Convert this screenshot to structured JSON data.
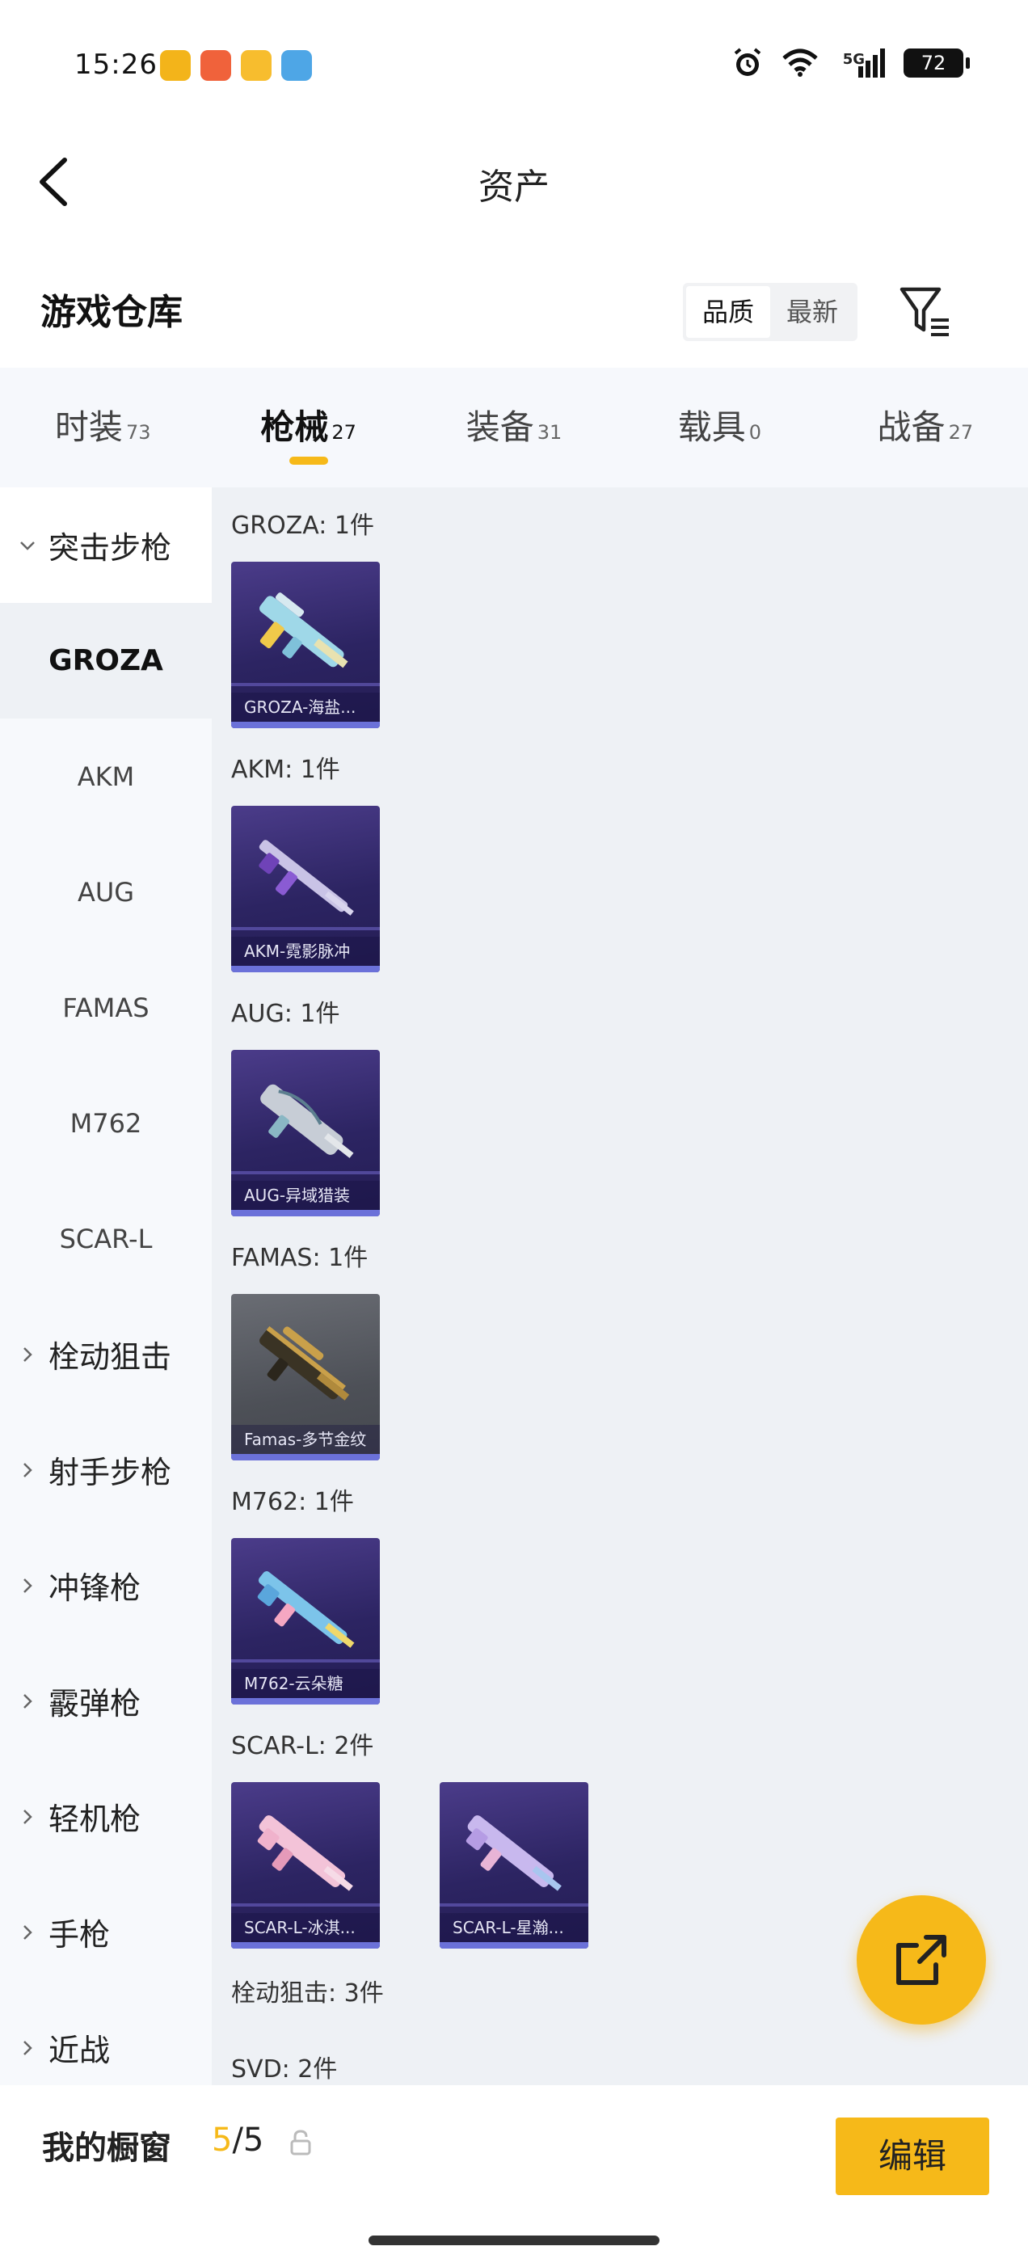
{
  "status_bar": {
    "time": "15:26",
    "battery": "72",
    "network": "5G",
    "icons": [
      "app-icon-1",
      "app-icon-2",
      "app-icon-3",
      "weather-icon",
      "alarm-icon",
      "wifi-icon",
      "signal-icon",
      "battery-icon"
    ]
  },
  "header": {
    "title": "资产"
  },
  "warehouse": {
    "title": "游戏仓库",
    "sort_options": [
      "品质",
      "最新"
    ],
    "active_sort": "品质"
  },
  "tabs": [
    {
      "label": "时装",
      "count": "73",
      "active": false
    },
    {
      "label": "枪械",
      "count": "27",
      "active": true
    },
    {
      "label": "装备",
      "count": "31",
      "active": false
    },
    {
      "label": "载具",
      "count": "0",
      "active": false
    },
    {
      "label": "战备",
      "count": "27",
      "active": false
    }
  ],
  "sidebar": {
    "categories": [
      {
        "label": "突击步枪",
        "expanded": true
      },
      {
        "label": "栓动狙击"
      },
      {
        "label": "射手步枪"
      },
      {
        "label": "冲锋枪"
      },
      {
        "label": "霰弹枪"
      },
      {
        "label": "轻机枪"
      },
      {
        "label": "手枪"
      },
      {
        "label": "近战"
      }
    ],
    "sub_items": [
      "GROZA",
      "AKM",
      "AUG",
      "FAMAS",
      "M762",
      "SCAR-L"
    ],
    "selected_sub": "GROZA"
  },
  "content": {
    "groups": [
      {
        "title": "GROZA: 1件",
        "items": [
          {
            "label": "GROZA-海盐...",
            "style": "purple"
          }
        ]
      },
      {
        "title": "AKM: 1件",
        "items": [
          {
            "label": "AKM-霓影脉冲",
            "style": "purple"
          }
        ]
      },
      {
        "title": "AUG: 1件",
        "items": [
          {
            "label": "AUG-异域猎装",
            "style": "purple"
          }
        ]
      },
      {
        "title": "FAMAS: 1件",
        "items": [
          {
            "label": "Famas-多节金纹",
            "style": "gray"
          }
        ]
      },
      {
        "title": "M762: 1件",
        "items": [
          {
            "label": "M762-云朵糖",
            "style": "purple"
          }
        ]
      },
      {
        "title": "SCAR-L: 2件",
        "items": [
          {
            "label": "SCAR-L-冰淇...",
            "style": "purple"
          },
          {
            "label": "SCAR-L-星瀚...",
            "style": "purple"
          }
        ]
      },
      {
        "title": "栓动狙击: 3件",
        "items": []
      },
      {
        "title": "SVD: 2件",
        "items": []
      }
    ]
  },
  "bottom_bar": {
    "showcase_label": "我的橱窗",
    "showcase_used": "5",
    "showcase_total": "/5",
    "edit_label": "编辑"
  },
  "colors": {
    "accent": "#f6b919",
    "card_purple": "#2c2462",
    "card_gray": "#4d5057",
    "content_bg": "#eef1f5",
    "tabs_bg": "#f6f8fc"
  }
}
